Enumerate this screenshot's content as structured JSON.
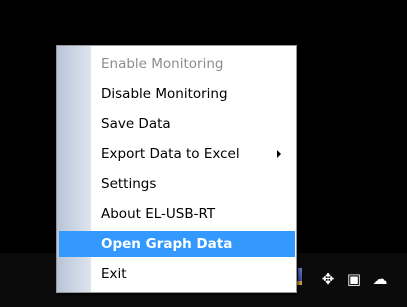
{
  "context_menu": {
    "items": [
      {
        "label": "Enable Monitoring",
        "state": "disabled"
      },
      {
        "label": "Disable Monitoring",
        "state": "normal"
      },
      {
        "label": "Save Data",
        "state": "normal"
      },
      {
        "label": "Export Data to Excel",
        "state": "normal",
        "has_submenu": true
      },
      {
        "label": "Settings",
        "state": "normal"
      },
      {
        "label": "About EL-USB-RT",
        "state": "normal"
      },
      {
        "label": "Open Graph Data",
        "state": "highlighted"
      },
      {
        "label": "Exit",
        "state": "normal"
      }
    ]
  },
  "tray": {
    "icons": [
      {
        "name": "app-icon",
        "glyph": ""
      },
      {
        "name": "dropbox-icon",
        "glyph": "✥"
      },
      {
        "name": "network-icon",
        "glyph": "▣"
      },
      {
        "name": "upload-cloud-icon",
        "glyph": "☁"
      }
    ]
  },
  "colors": {
    "highlight": "#3399ff",
    "disabled_text": "#8d8d8d"
  }
}
